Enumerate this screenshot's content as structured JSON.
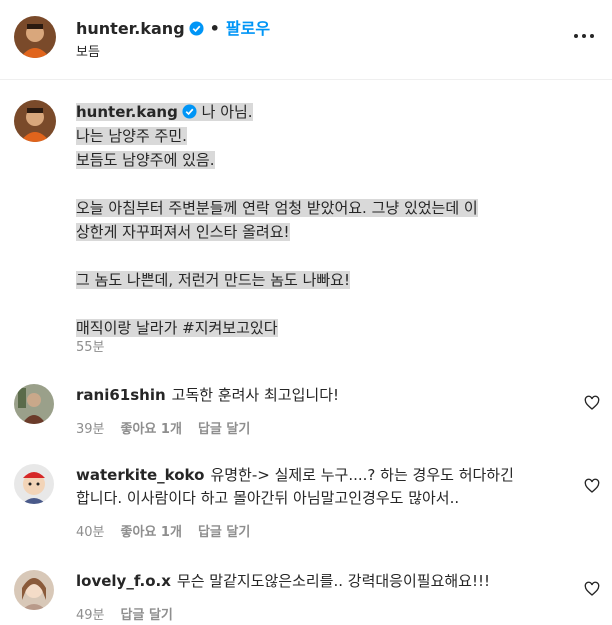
{
  "header": {
    "username": "hunter.kang",
    "separator": "•",
    "follow_label": "팔로우",
    "location": "보듬"
  },
  "caption": {
    "username": "hunter.kang",
    "lines": [
      "나 아님.",
      "나는 남양주 주민.",
      "보듬도 남양주에 있음.",
      "오늘 아침부터 주변분들께 연락 엄청 받았어요. 그냥 있었는데 이",
      "상한게 자꾸퍼져서 인스타 올려요!",
      "그 놈도 나쁜데, 저런거 만드는 놈도 나빠요!",
      "매직이랑 날라가 #지켜보고있다"
    ],
    "time": "55분"
  },
  "comments": [
    {
      "username": "rani61shin",
      "text": "고독한 훈려사 최고입니다!",
      "time": "39분",
      "likes": "좋아요 1개",
      "reply": "답글 달기"
    },
    {
      "username": "waterkite_koko",
      "text": "유명한-> 실제로 누구....? 하는 경우도 허다하긴",
      "text2": "합니다. 이사람이다 하고 몰아간뒤 아님말고인경우도 많아서..",
      "time": "40분",
      "likes": "좋아요 1개",
      "reply": "답글 달기"
    },
    {
      "username": "lovely_f.o.x",
      "text": "무슨 말같지도않은소리를.. 강력대응이필요해요!!!",
      "time": "49분",
      "likes": "",
      "reply": "답글 달기"
    }
  ],
  "icons": {
    "verified": "verified-badge-icon",
    "more": "more-options-icon",
    "heart": "heart-outline-icon"
  },
  "colors": {
    "follow": "#0095f6",
    "verified": "#0095f6",
    "meta": "#8e8e8e",
    "highlight": "#d9d9d9"
  }
}
